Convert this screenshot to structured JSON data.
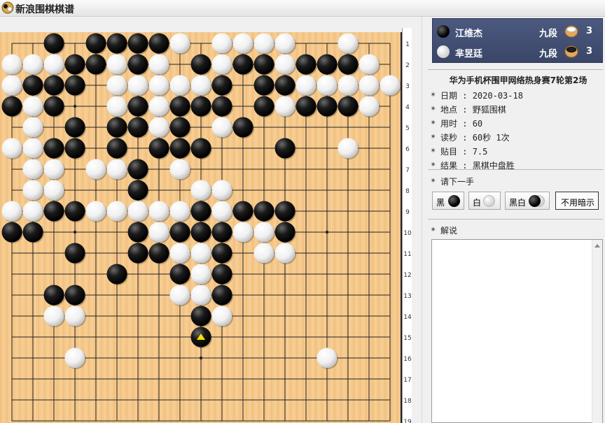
{
  "app": {
    "title": "新浪围棋棋谱"
  },
  "players": [
    {
      "color": "black",
      "name": "江维杰",
      "rank": "九段",
      "captures": "3"
    },
    {
      "color": "white",
      "name": "芈昱廷",
      "rank": "九段",
      "captures": "3"
    }
  ],
  "game": {
    "title": "华为手机杯围甲网络热身赛7轮第2场",
    "info": [
      {
        "label": "日期",
        "value": "2020-03-18"
      },
      {
        "label": "地点",
        "value": "野狐围棋"
      },
      {
        "label": "用时",
        "value": "60"
      },
      {
        "label": "读秒",
        "value": "60秒 1次"
      },
      {
        "label": "贴目",
        "value": "7.5"
      },
      {
        "label": "结果",
        "value": "黑棋中盘胜"
      }
    ]
  },
  "controls": {
    "prompt": "请下一手",
    "buttons": {
      "black": "黑",
      "white": "白",
      "black_white": "黑白",
      "no_hint": "不用暗示"
    },
    "commentary_label": "解说"
  },
  "board": {
    "size": 19,
    "row_labels": [
      "1",
      "2",
      "3",
      "4",
      "5",
      "6",
      "7",
      "8",
      "9",
      "10",
      "11",
      "12",
      "13",
      "14",
      "15",
      "16",
      "17",
      "18",
      "19"
    ],
    "stones": [
      {
        "c": "b",
        "x": 3,
        "y": 1
      },
      {
        "c": "b",
        "x": 5,
        "y": 1
      },
      {
        "c": "b",
        "x": 6,
        "y": 1
      },
      {
        "c": "b",
        "x": 7,
        "y": 1
      },
      {
        "c": "b",
        "x": 8,
        "y": 1
      },
      {
        "c": "w",
        "x": 9,
        "y": 1
      },
      {
        "c": "w",
        "x": 11,
        "y": 1
      },
      {
        "c": "w",
        "x": 12,
        "y": 1
      },
      {
        "c": "w",
        "x": 13,
        "y": 1
      },
      {
        "c": "w",
        "x": 14,
        "y": 1
      },
      {
        "c": "w",
        "x": 17,
        "y": 1
      },
      {
        "c": "w",
        "x": 1,
        "y": 2
      },
      {
        "c": "w",
        "x": 2,
        "y": 2
      },
      {
        "c": "w",
        "x": 3,
        "y": 2
      },
      {
        "c": "b",
        "x": 4,
        "y": 2
      },
      {
        "c": "b",
        "x": 5,
        "y": 2
      },
      {
        "c": "w",
        "x": 6,
        "y": 2
      },
      {
        "c": "b",
        "x": 7,
        "y": 2
      },
      {
        "c": "w",
        "x": 8,
        "y": 2
      },
      {
        "c": "b",
        "x": 10,
        "y": 2
      },
      {
        "c": "w",
        "x": 11,
        "y": 2
      },
      {
        "c": "b",
        "x": 12,
        "y": 2
      },
      {
        "c": "b",
        "x": 13,
        "y": 2
      },
      {
        "c": "w",
        "x": 14,
        "y": 2
      },
      {
        "c": "b",
        "x": 15,
        "y": 2
      },
      {
        "c": "b",
        "x": 16,
        "y": 2
      },
      {
        "c": "b",
        "x": 17,
        "y": 2
      },
      {
        "c": "w",
        "x": 18,
        "y": 2
      },
      {
        "c": "w",
        "x": 1,
        "y": 3
      },
      {
        "c": "b",
        "x": 2,
        "y": 3
      },
      {
        "c": "b",
        "x": 3,
        "y": 3
      },
      {
        "c": "b",
        "x": 4,
        "y": 3
      },
      {
        "c": "w",
        "x": 6,
        "y": 3
      },
      {
        "c": "w",
        "x": 7,
        "y": 3
      },
      {
        "c": "w",
        "x": 8,
        "y": 3
      },
      {
        "c": "w",
        "x": 9,
        "y": 3
      },
      {
        "c": "w",
        "x": 10,
        "y": 3
      },
      {
        "c": "b",
        "x": 11,
        "y": 3
      },
      {
        "c": "b",
        "x": 13,
        "y": 3
      },
      {
        "c": "b",
        "x": 14,
        "y": 3
      },
      {
        "c": "w",
        "x": 15,
        "y": 3
      },
      {
        "c": "w",
        "x": 16,
        "y": 3
      },
      {
        "c": "w",
        "x": 17,
        "y": 3
      },
      {
        "c": "w",
        "x": 18,
        "y": 3
      },
      {
        "c": "w",
        "x": 19,
        "y": 3
      },
      {
        "c": "b",
        "x": 1,
        "y": 4
      },
      {
        "c": "w",
        "x": 2,
        "y": 4
      },
      {
        "c": "b",
        "x": 3,
        "y": 4
      },
      {
        "c": "w",
        "x": 6,
        "y": 4
      },
      {
        "c": "b",
        "x": 7,
        "y": 4
      },
      {
        "c": "w",
        "x": 8,
        "y": 4
      },
      {
        "c": "b",
        "x": 9,
        "y": 4
      },
      {
        "c": "b",
        "x": 10,
        "y": 4
      },
      {
        "c": "b",
        "x": 11,
        "y": 4
      },
      {
        "c": "b",
        "x": 13,
        "y": 4
      },
      {
        "c": "w",
        "x": 14,
        "y": 4
      },
      {
        "c": "b",
        "x": 15,
        "y": 4
      },
      {
        "c": "b",
        "x": 16,
        "y": 4
      },
      {
        "c": "b",
        "x": 17,
        "y": 4
      },
      {
        "c": "w",
        "x": 18,
        "y": 4
      },
      {
        "c": "w",
        "x": 2,
        "y": 5
      },
      {
        "c": "b",
        "x": 4,
        "y": 5
      },
      {
        "c": "b",
        "x": 6,
        "y": 5
      },
      {
        "c": "b",
        "x": 7,
        "y": 5
      },
      {
        "c": "w",
        "x": 8,
        "y": 5
      },
      {
        "c": "b",
        "x": 9,
        "y": 5
      },
      {
        "c": "w",
        "x": 11,
        "y": 5
      },
      {
        "c": "b",
        "x": 12,
        "y": 5
      },
      {
        "c": "w",
        "x": 1,
        "y": 6
      },
      {
        "c": "w",
        "x": 2,
        "y": 6
      },
      {
        "c": "b",
        "x": 3,
        "y": 6
      },
      {
        "c": "b",
        "x": 4,
        "y": 6
      },
      {
        "c": "b",
        "x": 6,
        "y": 6
      },
      {
        "c": "b",
        "x": 8,
        "y": 6
      },
      {
        "c": "b",
        "x": 9,
        "y": 6
      },
      {
        "c": "b",
        "x": 10,
        "y": 6
      },
      {
        "c": "b",
        "x": 14,
        "y": 6
      },
      {
        "c": "w",
        "x": 17,
        "y": 6
      },
      {
        "c": "w",
        "x": 2,
        "y": 7
      },
      {
        "c": "w",
        "x": 3,
        "y": 7
      },
      {
        "c": "w",
        "x": 5,
        "y": 7
      },
      {
        "c": "w",
        "x": 6,
        "y": 7
      },
      {
        "c": "b",
        "x": 7,
        "y": 7
      },
      {
        "c": "w",
        "x": 9,
        "y": 7
      },
      {
        "c": "w",
        "x": 2,
        "y": 8
      },
      {
        "c": "w",
        "x": 3,
        "y": 8
      },
      {
        "c": "b",
        "x": 7,
        "y": 8
      },
      {
        "c": "w",
        "x": 10,
        "y": 8
      },
      {
        "c": "w",
        "x": 11,
        "y": 8
      },
      {
        "c": "w",
        "x": 1,
        "y": 9
      },
      {
        "c": "w",
        "x": 2,
        "y": 9
      },
      {
        "c": "b",
        "x": 3,
        "y": 9
      },
      {
        "c": "b",
        "x": 4,
        "y": 9
      },
      {
        "c": "w",
        "x": 5,
        "y": 9
      },
      {
        "c": "w",
        "x": 6,
        "y": 9
      },
      {
        "c": "w",
        "x": 7,
        "y": 9
      },
      {
        "c": "w",
        "x": 8,
        "y": 9
      },
      {
        "c": "w",
        "x": 9,
        "y": 9
      },
      {
        "c": "b",
        "x": 10,
        "y": 9
      },
      {
        "c": "w",
        "x": 11,
        "y": 9
      },
      {
        "c": "b",
        "x": 12,
        "y": 9
      },
      {
        "c": "b",
        "x": 13,
        "y": 9
      },
      {
        "c": "b",
        "x": 14,
        "y": 9
      },
      {
        "c": "b",
        "x": 1,
        "y": 10
      },
      {
        "c": "b",
        "x": 2,
        "y": 10
      },
      {
        "c": "b",
        "x": 7,
        "y": 10
      },
      {
        "c": "w",
        "x": 8,
        "y": 10
      },
      {
        "c": "b",
        "x": 9,
        "y": 10
      },
      {
        "c": "b",
        "x": 10,
        "y": 10
      },
      {
        "c": "b",
        "x": 11,
        "y": 10
      },
      {
        "c": "w",
        "x": 12,
        "y": 10
      },
      {
        "c": "w",
        "x": 13,
        "y": 10
      },
      {
        "c": "b",
        "x": 14,
        "y": 10
      },
      {
        "c": "b",
        "x": 4,
        "y": 11
      },
      {
        "c": "b",
        "x": 7,
        "y": 11
      },
      {
        "c": "b",
        "x": 8,
        "y": 11
      },
      {
        "c": "w",
        "x": 9,
        "y": 11
      },
      {
        "c": "w",
        "x": 10,
        "y": 11
      },
      {
        "c": "b",
        "x": 11,
        "y": 11
      },
      {
        "c": "w",
        "x": 13,
        "y": 11
      },
      {
        "c": "w",
        "x": 14,
        "y": 11
      },
      {
        "c": "b",
        "x": 6,
        "y": 12
      },
      {
        "c": "b",
        "x": 9,
        "y": 12
      },
      {
        "c": "w",
        "x": 10,
        "y": 12
      },
      {
        "c": "b",
        "x": 11,
        "y": 12
      },
      {
        "c": "b",
        "x": 3,
        "y": 13
      },
      {
        "c": "b",
        "x": 4,
        "y": 13
      },
      {
        "c": "w",
        "x": 9,
        "y": 13
      },
      {
        "c": "w",
        "x": 10,
        "y": 13
      },
      {
        "c": "b",
        "x": 11,
        "y": 13
      },
      {
        "c": "w",
        "x": 3,
        "y": 14
      },
      {
        "c": "w",
        "x": 4,
        "y": 14
      },
      {
        "c": "b",
        "x": 10,
        "y": 14
      },
      {
        "c": "w",
        "x": 11,
        "y": 14
      },
      {
        "c": "b",
        "x": 10,
        "y": 15,
        "last": true
      },
      {
        "c": "w",
        "x": 4,
        "y": 16
      },
      {
        "c": "w",
        "x": 16,
        "y": 16
      }
    ],
    "star_points": [
      [
        4,
        4
      ],
      [
        10,
        4
      ],
      [
        16,
        4
      ],
      [
        4,
        10
      ],
      [
        10,
        10
      ],
      [
        16,
        10
      ],
      [
        4,
        16
      ],
      [
        10,
        16
      ],
      [
        16,
        16
      ]
    ]
  }
}
